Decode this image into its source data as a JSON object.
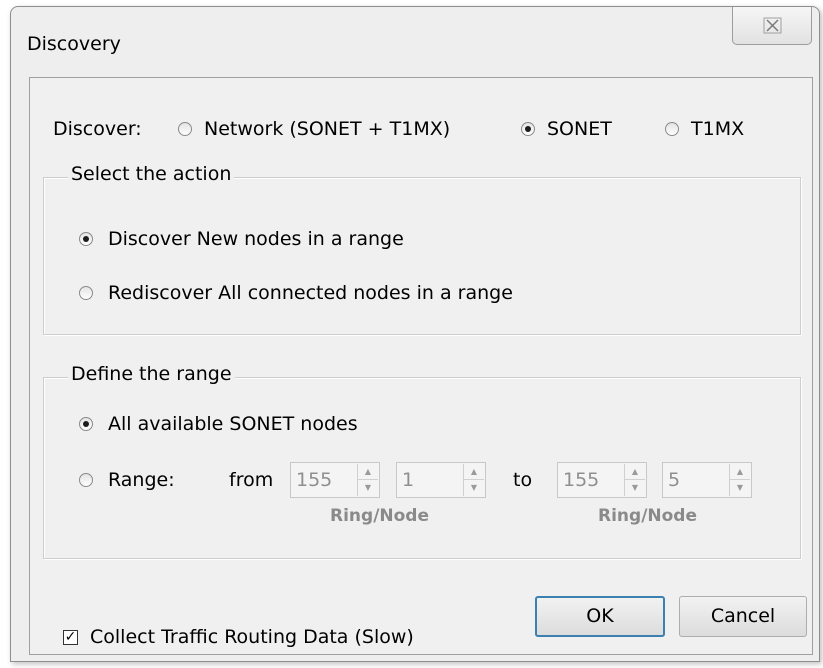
{
  "window": {
    "title": "Discovery",
    "close_glyph": "⌧"
  },
  "discover": {
    "label": "Discover:",
    "options": [
      {
        "label": "Network (SONET + T1MX)",
        "checked": false
      },
      {
        "label": "SONET",
        "checked": true
      },
      {
        "label": "T1MX",
        "checked": false
      }
    ]
  },
  "action_group": {
    "title": "Select the action",
    "options": [
      {
        "label": "Discover New nodes in a range",
        "checked": true
      },
      {
        "label": "Rediscover All connected nodes in a range",
        "checked": false
      }
    ]
  },
  "range_group": {
    "title": "Define the range",
    "all_option": {
      "label": "All available SONET nodes",
      "checked": true
    },
    "range_option": {
      "label": "Range:",
      "checked": false
    },
    "from_label": "from",
    "to_label": "to",
    "from_ring": "155",
    "from_node": "1",
    "to_ring": "155",
    "to_node": "5",
    "ring_node_label": "Ring/Node",
    "spin_up_glyph": "▲",
    "spin_down_glyph": "▼"
  },
  "collect_checkbox": {
    "label": "Collect Traffic Routing Data (Slow)",
    "checked": true,
    "glyph": "✓"
  },
  "buttons": {
    "ok": "OK",
    "cancel": "Cancel"
  }
}
